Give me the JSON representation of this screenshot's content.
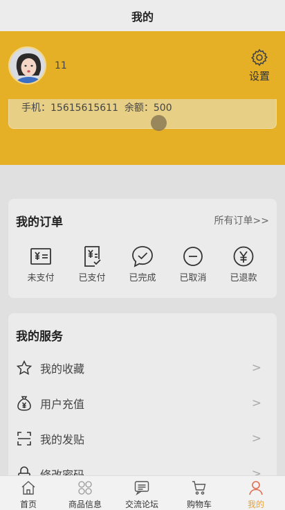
{
  "header": {
    "title": "我的"
  },
  "profile": {
    "username": "11",
    "settings_label": "设置",
    "phone_label": "手机：",
    "phone": "15615615611",
    "balance_label": "余额：",
    "balance": "500"
  },
  "orders": {
    "title": "我的订单",
    "all_link": "所有订单>>",
    "items": [
      {
        "label": "未支付",
        "icon": "cash-icon"
      },
      {
        "label": "已支付",
        "icon": "receipt-icon"
      },
      {
        "label": "已完成",
        "icon": "chat-check-icon"
      },
      {
        "label": "已取消",
        "icon": "minus-circle-icon"
      },
      {
        "label": "已退款",
        "icon": "yen-circle-icon"
      }
    ]
  },
  "services": {
    "title": "我的服务",
    "items": [
      {
        "label": "我的收藏",
        "icon": "star-icon"
      },
      {
        "label": "用户充值",
        "icon": "money-bag-icon"
      },
      {
        "label": "我的发贴",
        "icon": "scan-icon"
      },
      {
        "label": "修改密码",
        "icon": "lock-icon"
      }
    ],
    "arrow": ">"
  },
  "tabbar": {
    "items": [
      {
        "label": "首页",
        "icon": "home-icon"
      },
      {
        "label": "商品信息",
        "icon": "grid-icon"
      },
      {
        "label": "交流论坛",
        "icon": "forum-icon"
      },
      {
        "label": "购物车",
        "icon": "cart-icon"
      },
      {
        "label": "我的",
        "icon": "user-icon",
        "active": true
      }
    ]
  },
  "colors": {
    "accent": "#e5b026",
    "active_tab": "#e6a23c"
  }
}
